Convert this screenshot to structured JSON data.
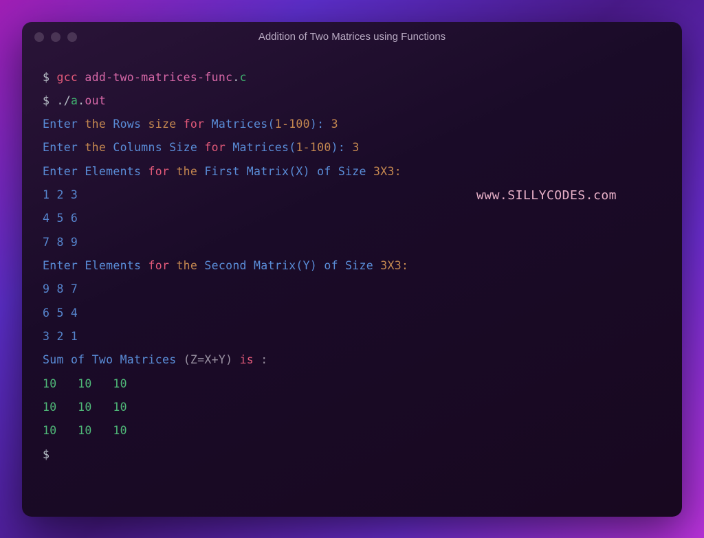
{
  "window": {
    "title": "Addition of Two Matrices using Functions"
  },
  "watermark": "www.SILLYCODES.com",
  "terminal": {
    "prompt": "$",
    "compile_cmd": {
      "gcc": "gcc",
      "file": "add-two-matrices-func",
      "dot": ".",
      "ext": "c"
    },
    "run_cmd": {
      "dotslash": "./",
      "a": "a",
      "dot": ".",
      "out": "out"
    },
    "rows_prompt": {
      "enter": "Enter",
      "the": "the",
      "rows": "Rows",
      "size": "size",
      "for_": "for",
      "matrices": "Matrices(",
      "range": "1-100",
      "paren": "): ",
      "value": "3"
    },
    "cols_prompt": {
      "enter": "Enter",
      "the": "the",
      "columns": "Columns",
      "size": "Size",
      "for_": "for",
      "matrices": "Matrices(",
      "range": "1-100",
      "paren": "): ",
      "value": "3"
    },
    "first_matrix_prompt": {
      "enter": "Enter",
      "elements": "Elements",
      "for_": "for",
      "the": "the",
      "first": "First",
      "matrix": "Matrix(X)",
      "of": "of",
      "size": "Size",
      "dims": "3X3:"
    },
    "first_matrix_rows": [
      "1 2 3",
      "4 5 6",
      "7 8 9"
    ],
    "second_matrix_prompt": {
      "enter": "Enter",
      "elements": "Elements",
      "for_": "for",
      "the": "the",
      "second": "Second",
      "matrix": "Matrix(Y)",
      "of": "of",
      "size": "Size",
      "dims": "3X3:"
    },
    "second_matrix_rows": [
      "9 8 7",
      "6 5 4",
      "3 2 1"
    ],
    "sum_prompt": {
      "sum": "Sum",
      "of": "of",
      "two": "Two",
      "matrices": "Matrices",
      "expr": "(Z=X+Y)",
      "is_": "is",
      "colon": ":"
    },
    "result_rows": [
      "10   10   10",
      "10   10   10",
      "10   10   10"
    ]
  }
}
